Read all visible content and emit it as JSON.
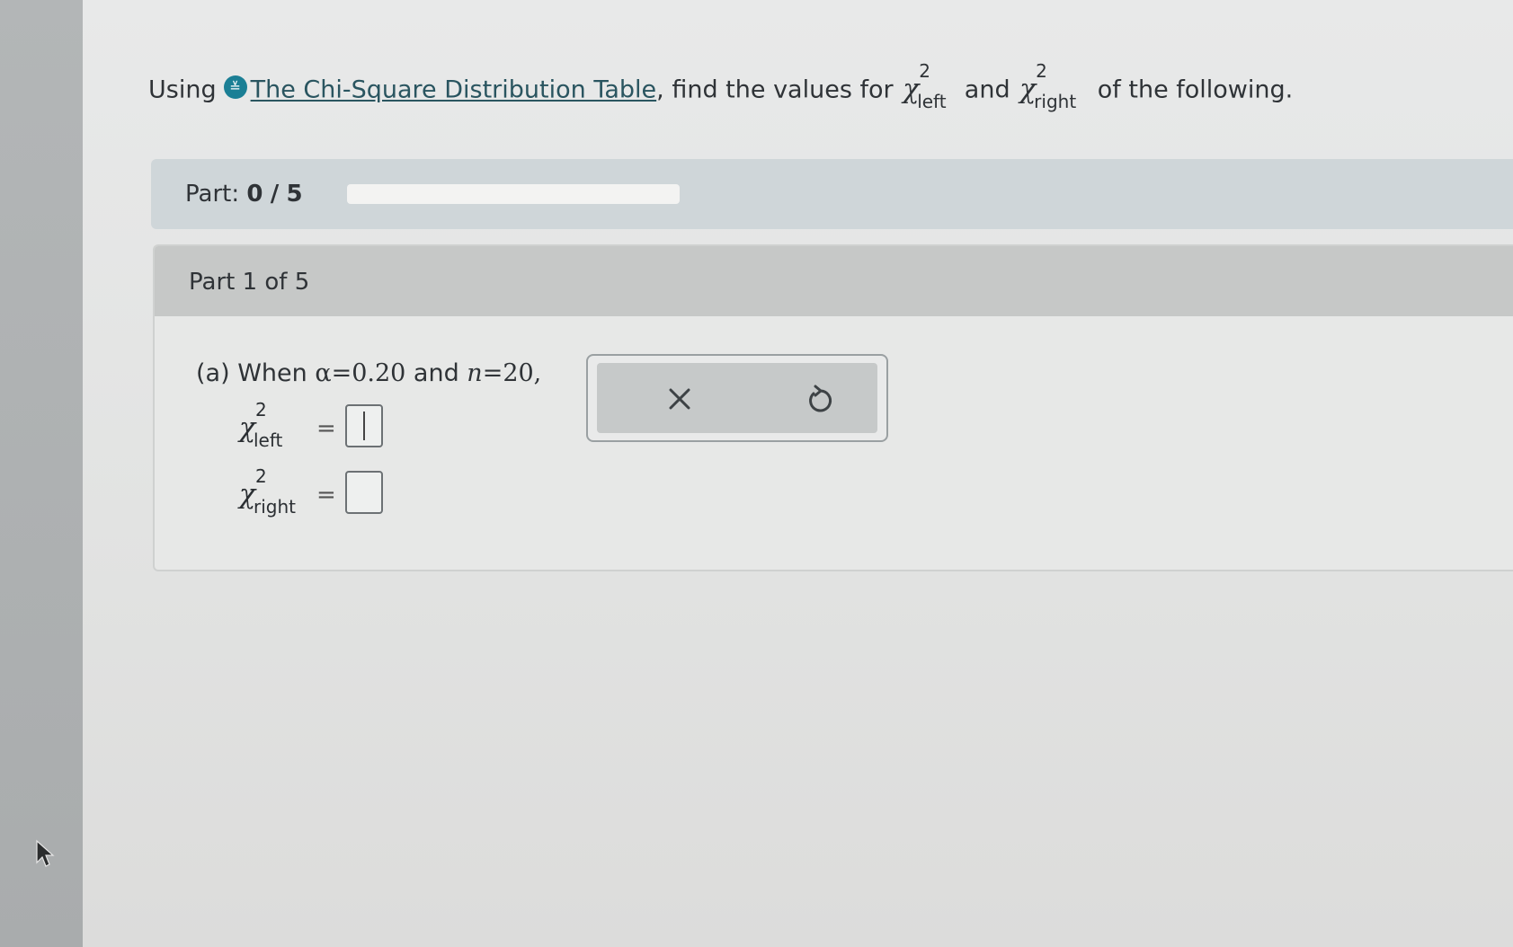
{
  "question": {
    "prefix": "Using",
    "info_icon_glyph": "≚",
    "link_text": "The Chi-Square Distribution Table",
    "middle": ", find the values for",
    "and": "and",
    "suffix": "of the following.",
    "chi_symbol": "χ",
    "superscript": "2",
    "left_sub": "left",
    "right_sub": "right"
  },
  "progress": {
    "label": "Part:",
    "current": "0",
    "separator": "/",
    "total": "5",
    "fraction_complete": 0,
    "fill_color": "#2a8aa0"
  },
  "part": {
    "title": "Part 1 of 5",
    "prompt_label": "(a) When",
    "alpha_symbol": "α",
    "alpha_eq": "=",
    "alpha_value": "0.20",
    "and": "and",
    "n_symbol": "n",
    "n_eq": "=",
    "n_value": "20,",
    "answers": [
      {
        "symbol": "χ",
        "sup": "2",
        "sub": "left",
        "equals": "=",
        "value": ""
      },
      {
        "symbol": "χ",
        "sup": "2",
        "sub": "right",
        "equals": "=",
        "value": ""
      }
    ]
  },
  "tools": {
    "clear_icon": "close-icon",
    "undo_icon": "undo-icon"
  },
  "colors": {
    "accent": "#1b7f95",
    "header_gray": "#c6c8c7",
    "progress_bg": "#cfd6d9"
  }
}
